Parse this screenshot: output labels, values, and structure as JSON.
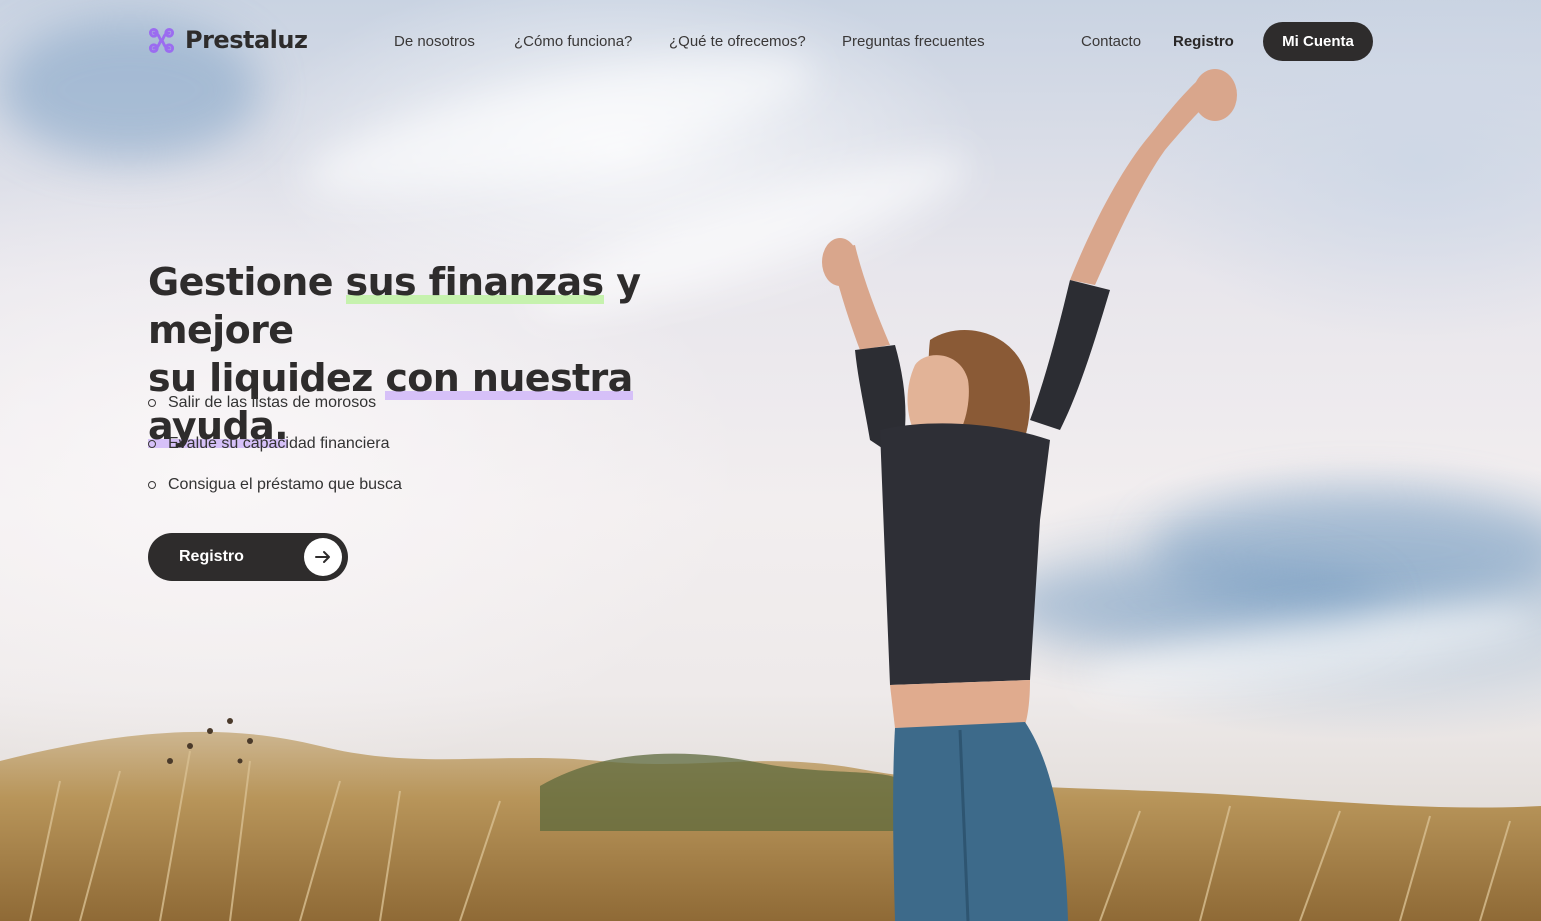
{
  "brand": {
    "name": "Prestaluz",
    "icon": "logo-knot-icon",
    "accent": "#9b6cf0"
  },
  "nav": {
    "links": [
      {
        "label": "De nosotros"
      },
      {
        "label": "¿Cómo funciona?"
      },
      {
        "label": "¿Qué te ofrecemos?"
      },
      {
        "label": "Preguntas frecuentes"
      },
      {
        "label": "Contacto"
      },
      {
        "label": "Registro"
      }
    ],
    "account_label": "Mi Cuenta"
  },
  "hero": {
    "title_parts": [
      "Gestione ",
      "sus finanzas",
      " y mejore",
      "su liquidez ",
      "con nuestra ayuda."
    ],
    "features": [
      "Salir de las listas de morosos",
      "Evalúe su capacidad financiera",
      "Consigua el préstamo que busca"
    ],
    "cta_label": "Registro",
    "cta_icon": "arrow-right-icon"
  },
  "colors": {
    "dark": "#2e2c2c",
    "highlight_green": "#c4f2aa",
    "highlight_purple": "#d4bef8"
  }
}
